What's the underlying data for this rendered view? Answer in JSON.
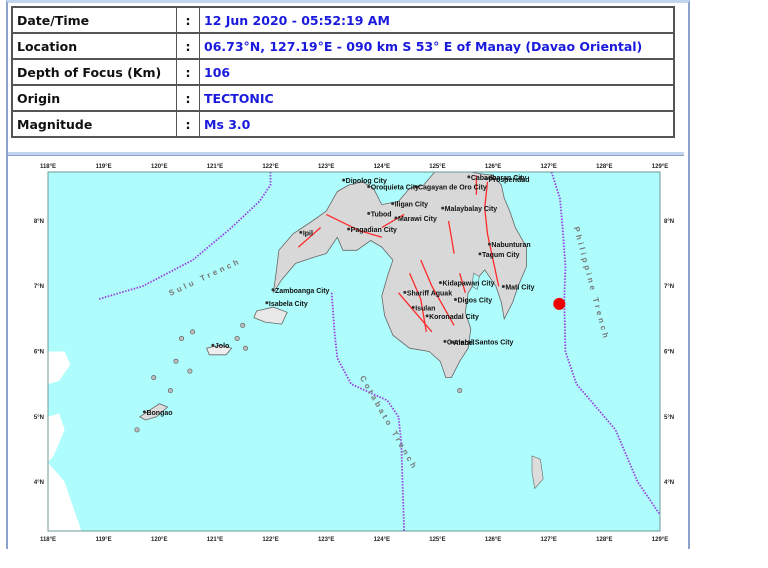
{
  "report": {
    "rows": [
      {
        "label": "Date/Time",
        "colon": ":",
        "value": "12 Jun 2020 - 05:52:19 AM"
      },
      {
        "label": "Location",
        "colon": ":",
        "value": "06.73°N, 127.19°E - 090 km S 53° E of Manay (Davao Oriental)"
      },
      {
        "label": "Depth of Focus (Km)",
        "colon": ":",
        "value": "106"
      },
      {
        "label": "Origin",
        "colon": ":",
        "value": "TECTONIC"
      },
      {
        "label": "Magnitude",
        "colon": ":",
        "value": "Ms 3.0"
      }
    ]
  },
  "map": {
    "colors": {
      "sea": "#aefcfc",
      "land": "#d8d8d8",
      "fault": "#ff2a2a",
      "trench": "#9a3ee0",
      "epicenter": "#ee0000",
      "trench_label": "#777777"
    },
    "lon_ticks": [
      "118°E",
      "119°E",
      "120°E",
      "121°E",
      "122°E",
      "123°E",
      "124°E",
      "125°E",
      "126°E",
      "127°E",
      "128°E",
      "129°E"
    ],
    "lat_ticks": [
      "8°N",
      "7°N",
      "6°N",
      "5°N",
      "4°N"
    ],
    "lon_range": [
      118,
      129
    ],
    "lat_range": [
      3.25,
      8.75
    ],
    "epicenter": {
      "lat": 6.73,
      "lon": 127.19
    },
    "cities": [
      {
        "name": "Cabadbaran City",
        "lon": 125.6,
        "lat": 8.63
      },
      {
        "name": "Dipolog City",
        "lon": 123.35,
        "lat": 8.58
      },
      {
        "name": "Cagayan de Oro City",
        "lon": 124.65,
        "lat": 8.48
      },
      {
        "name": "Prosperidad",
        "lon": 125.92,
        "lat": 8.6
      },
      {
        "name": "Oroquieta City",
        "lon": 123.8,
        "lat": 8.48
      },
      {
        "name": "Iligan City",
        "lon": 124.23,
        "lat": 8.22
      },
      {
        "name": "Tubod",
        "lon": 123.8,
        "lat": 8.07
      },
      {
        "name": "Malaybalay City",
        "lon": 125.13,
        "lat": 8.15
      },
      {
        "name": "Marawi City",
        "lon": 124.29,
        "lat": 8.0
      },
      {
        "name": "Nabunturan",
        "lon": 125.97,
        "lat": 7.6
      },
      {
        "name": "Ipil",
        "lon": 122.58,
        "lat": 7.78
      },
      {
        "name": "Pagadian City",
        "lon": 123.44,
        "lat": 7.83
      },
      {
        "name": "Tagum City",
        "lon": 125.8,
        "lat": 7.45
      },
      {
        "name": "Kidapawan City",
        "lon": 125.09,
        "lat": 7.01
      },
      {
        "name": "Mati City",
        "lon": 126.22,
        "lat": 6.95
      },
      {
        "name": "Zamboanga City",
        "lon": 122.08,
        "lat": 6.9
      },
      {
        "name": "Shariff Aguak",
        "lon": 124.45,
        "lat": 6.86
      },
      {
        "name": "Isabela City",
        "lon": 121.97,
        "lat": 6.7
      },
      {
        "name": "Isulan",
        "lon": 124.6,
        "lat": 6.63
      },
      {
        "name": "Digos City",
        "lon": 125.36,
        "lat": 6.75
      },
      {
        "name": "Koronadal City",
        "lon": 124.85,
        "lat": 6.5
      },
      {
        "name": "General Santos City",
        "lon": 125.17,
        "lat": 6.11
      },
      {
        "name": "Alabel",
        "lon": 125.29,
        "lat": 6.1
      },
      {
        "name": "Jolo",
        "lon": 121.0,
        "lat": 6.05
      },
      {
        "name": "Bongao",
        "lon": 119.77,
        "lat": 5.03
      }
    ],
    "trench_labels": [
      {
        "name": "Sulu Trench"
      },
      {
        "name": "Cotabato Trench"
      },
      {
        "name": "Philippine Trench"
      }
    ]
  }
}
